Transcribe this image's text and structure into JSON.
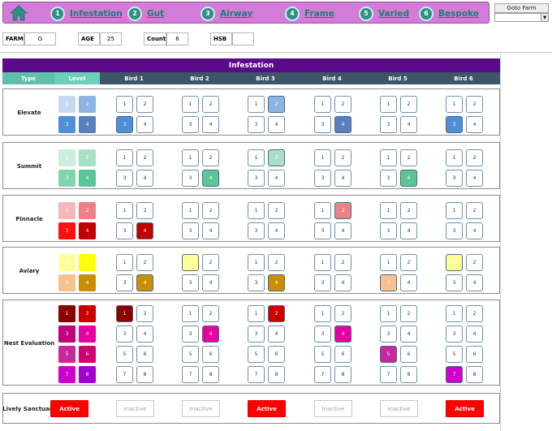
{
  "nav": {
    "home_icon": "home-icon",
    "items": [
      {
        "num": "1",
        "label": "Infestation"
      },
      {
        "num": "2",
        "label": "Gut"
      },
      {
        "num": "3",
        "label": "Airway"
      },
      {
        "num": "4",
        "label": "Frame"
      },
      {
        "num": "5",
        "label": "Varied"
      },
      {
        "num": "6",
        "label": "Bespoke"
      }
    ],
    "goto_farm_label": "Goto Farm",
    "goto_farm_value": ""
  },
  "info": {
    "farm_label": "FARM",
    "farm_value": "G",
    "age_label": "AGE",
    "age_value": "25",
    "count_label": "Count",
    "count_value": "6",
    "hsb_label": "HSB",
    "hsb_value": ""
  },
  "table": {
    "title": "Infestation",
    "type_header": "Type",
    "level_header": "Level",
    "birds": [
      "Bird 1",
      "Bird 2",
      "Bird 3",
      "Bird 4",
      "Bird 5",
      "Bird 6"
    ]
  },
  "sections": [
    {
      "name": "Elevate",
      "levels": [
        "1",
        "2",
        "3",
        "4"
      ],
      "colors": [
        "#c6d9f1",
        "#8db4e2",
        "#4f8fd6",
        "#5a7fbf"
      ],
      "selected": [
        3,
        0,
        2,
        4,
        0,
        3
      ]
    },
    {
      "name": "Summit",
      "levels": [
        "1",
        "2",
        "3",
        "4"
      ],
      "colors": [
        "#c9eedb",
        "#a8e0c5",
        "#7fd6ad",
        "#5bc596"
      ],
      "selected": [
        0,
        4,
        2,
        0,
        4,
        0
      ]
    },
    {
      "name": "Pinnacle",
      "levels": [
        "1",
        "2",
        "3",
        "4"
      ],
      "colors": [
        "#f4b7bc",
        "#f08088",
        "#ff1010",
        "#c00000"
      ],
      "selected": [
        4,
        0,
        0,
        2,
        0,
        0
      ]
    },
    {
      "name": "Aviary",
      "levels": [
        "1",
        "2",
        "3",
        "4"
      ],
      "colors": [
        "#ffff99",
        "#ffff00",
        "#f9c08f",
        "#c89000"
      ],
      "selected": [
        4,
        1,
        4,
        0,
        3,
        1
      ]
    },
    {
      "name": "Nest Evaluation",
      "levels": [
        "1",
        "2",
        "3",
        "4",
        "5",
        "6",
        "7",
        "8"
      ],
      "colors": [
        "#8b0000",
        "#cc0000",
        "#c0007a",
        "#e600a0",
        "#c8279e",
        "#d00070",
        "#cc00cc",
        "#a000d0"
      ],
      "selected": [
        1,
        4,
        2,
        4,
        5,
        7
      ]
    },
    {
      "name": "Lively Sanctuary",
      "buttons": [
        "Active",
        "Inactive",
        "Inactive",
        "Active",
        "Inactive",
        "Inactive",
        "Active"
      ]
    }
  ]
}
